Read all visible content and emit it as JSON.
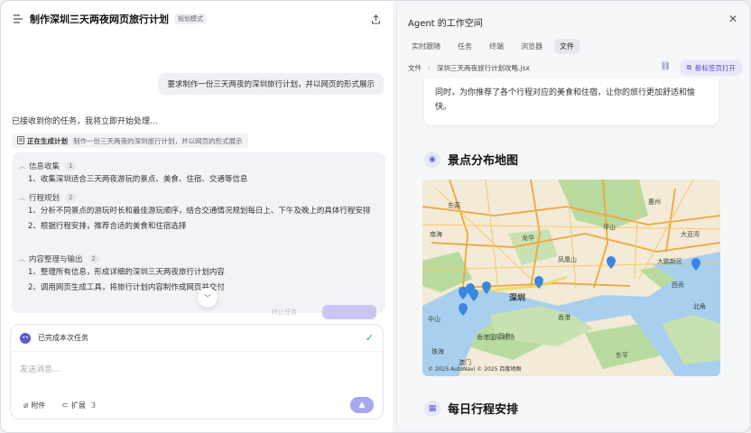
{
  "left": {
    "title": "制作深圳三天两夜网页旅行计划",
    "mode_badge": "规划模式",
    "user_message": "要求制作一份三天两夜的深圳旅行计划，并以网页的形式展示",
    "reply": "已接收到你的任务，我将立即开始处理...",
    "status": {
      "label": "正在生成计划",
      "text": "制作一份三天两夜的深圳旅行计划，并以网页的形式展示"
    },
    "plan": [
      {
        "title": "信息收集",
        "count": "1",
        "items": [
          "1、收集深圳适合三天两夜游玩的景点、美食、住宿、交通等信息"
        ]
      },
      {
        "title": "行程规划",
        "count": "2",
        "items": [
          "1、分析不同景点的游玩时长和最佳游玩顺序，结合交通情况规划每日上、下午及晚上的具体行程安排",
          "2、根据行程安排，推荐合适的美食和住宿选择"
        ]
      },
      {
        "title": "内容整理与输出",
        "count": "2",
        "items": [
          "1、整理所有信息，形成详细的深圳三天两夜旅行计划内容",
          "2、调用网页生成工具，将旅行计划内容制作成网页并交付"
        ]
      }
    ],
    "faded_label": "终止任务",
    "composer": {
      "done_text": "已完成本次任务",
      "placeholder": "发送消息...",
      "attach_label": "附件",
      "extend_label": "扩展",
      "extend_count": "3"
    }
  },
  "right": {
    "title": "Agent 的工作空间",
    "tabs": [
      "实时跟随",
      "任务",
      "终端",
      "浏览器",
      "文件"
    ],
    "file_bar": {
      "root": "文件",
      "filename": "深圳三天两夜旅行计划攻略.jsx"
    },
    "open_btn": "新标签页打开",
    "intro": "同时，为你推荐了各个行程对应的美食和住宿，让你的旅行更加舒适和愉快。",
    "map_section_title": "景点分布地图",
    "map": {
      "city_label": "深圳",
      "labels": [
        "东莞",
        "惠州",
        "大鹏新区",
        "香港",
        "西贡",
        "北角",
        "香港国际机场",
        "中山",
        "珠海",
        "澳门",
        "南海",
        "三乡",
        "坪山",
        "龙华",
        "凤凰山",
        "大亚湾",
        "东平"
      ],
      "credit": "© 2025 AutoNavi © 2025 百度地图"
    },
    "schedule_section_title": "每日行程安排"
  },
  "colors": {
    "accent": "#5b5bd6",
    "send": "#a9a6f0",
    "check": "#3fa45b"
  }
}
